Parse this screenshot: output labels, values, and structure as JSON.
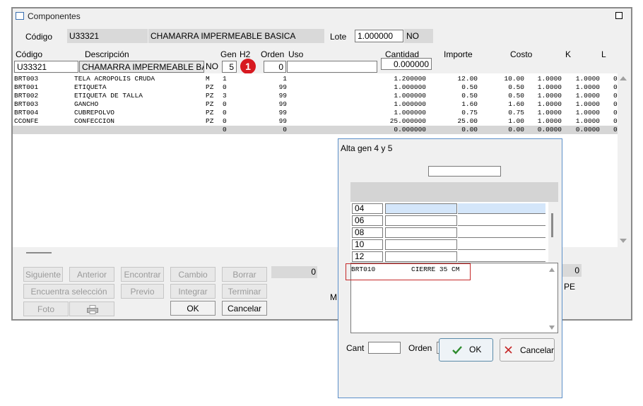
{
  "window": {
    "title": "Componentes"
  },
  "header": {
    "codigo_label": "Código",
    "codigo_value": "U33321",
    "descripcion_value": "CHAMARRA IMPERMEABLE BASICA",
    "lote_label": "Lote",
    "lote_value": "1.000000",
    "no_value": "NO"
  },
  "columns": {
    "codigo": "Código",
    "descripcion": "Descripción",
    "gen": "Gen",
    "h2": "H2",
    "orden": "Orden",
    "uso": "Uso",
    "cantidad": "Cantidad",
    "importe": "Importe",
    "costo": "Costo",
    "k": "K",
    "l": "L"
  },
  "edit_row": {
    "codigo": "U33321",
    "descripcion": "CHAMARRA IMPERMEABLE BASICA",
    "no": "NO",
    "gen": "5",
    "orden": "0",
    "cantidad": "0.000000",
    "badge": "1"
  },
  "rows": [
    [
      "BRT003",
      "TELA ACROPOLIS CRUDA",
      "M",
      "1",
      "1",
      "1.200000",
      "12.00",
      "10.00",
      "1.0000",
      "1.0000",
      "0"
    ],
    [
      "BRT001",
      "ETIQUETA",
      "PZ",
      "0",
      "99",
      "1.000000",
      "0.50",
      "0.50",
      "1.0000",
      "1.0000",
      "0"
    ],
    [
      "BRT002",
      "ETIQUETA DE TALLA",
      "PZ",
      "3",
      "99",
      "1.000000",
      "0.50",
      "0.50",
      "1.0000",
      "1.0000",
      "0"
    ],
    [
      "BRT003",
      "GANCHO",
      "PZ",
      "0",
      "99",
      "1.000000",
      "1.60",
      "1.60",
      "1.0000",
      "1.0000",
      "0"
    ],
    [
      "BRT004",
      "CUBREPOLVO",
      "PZ",
      "0",
      "99",
      "1.000000",
      "0.75",
      "0.75",
      "1.0000",
      "1.0000",
      "0"
    ],
    [
      "CCONFE",
      "CONFECCION",
      "PZ",
      "0",
      "99",
      "25.000000",
      "25.00",
      "1.00",
      "1.0000",
      "1.0000",
      "0"
    ],
    [
      "",
      "",
      "",
      "0",
      "0",
      "0.000000",
      "0.00",
      "0.00",
      "0.0000",
      "0.0000",
      "0"
    ]
  ],
  "buttons": {
    "siguiente": "Siguiente",
    "anterior": "Anterior",
    "encontrar": "Encontrar",
    "cambio": "Cambio",
    "borrar": "Borrar",
    "encuentra": "Encuentra selección",
    "previo": "Previo",
    "integrar": "Integrar",
    "terminar": "Terminar",
    "foto": "Foto",
    "ok": "OK",
    "cancelar": "Cancelar"
  },
  "bottom": {
    "field_zero": "0",
    "right_zero": "0",
    "pe": "PE",
    "m": "M"
  },
  "dialog": {
    "title": "Alta gen 4 y 5",
    "list": [
      "04",
      "06",
      "08",
      "10",
      "12"
    ],
    "memo_code": "BRT010",
    "memo_desc": "CIERRE 35 CM",
    "cant_label": "Cant",
    "orden_label": "Orden",
    "ok": "OK",
    "cancelar": "Cancelar"
  },
  "colors": {
    "badge": "#d71920",
    "memo_highlight": "#c62828",
    "ok_check": "#2e8b2e",
    "cancel_x": "#c62828",
    "dialog_border": "#5b8fc9"
  }
}
